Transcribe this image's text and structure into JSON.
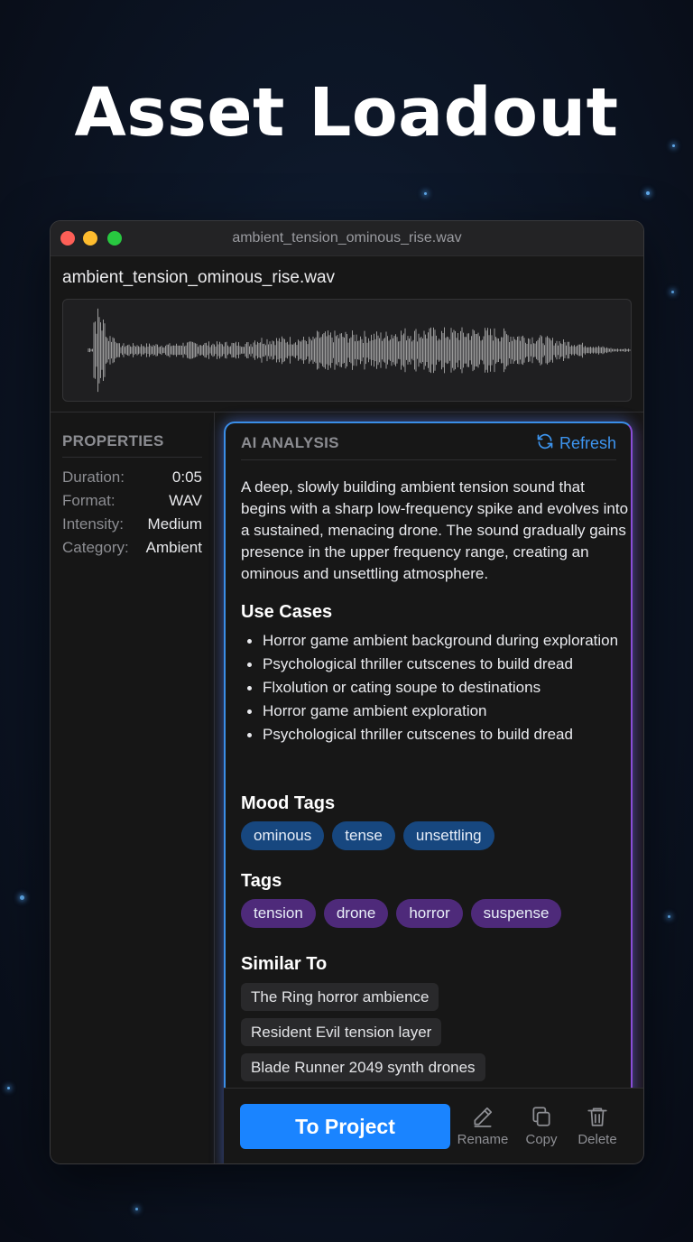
{
  "hero": {
    "title": "Asset Loadout"
  },
  "window": {
    "title": "ambient_tension_ominous_rise.wav",
    "file_name": "ambient_tension_ominous_rise.wav"
  },
  "properties": {
    "heading": "PROPERTIES",
    "rows": [
      {
        "key": "Duration:",
        "value": "0:05"
      },
      {
        "key": "Format:",
        "value": "WAV"
      },
      {
        "key": "Intensity:",
        "value": "Medium"
      },
      {
        "key": "Category:",
        "value": "Ambient"
      }
    ]
  },
  "analysis": {
    "heading": "AI ANALYSIS",
    "refresh_label": "Refresh",
    "description": "A deep, slowly building ambient tension sound that begins with a sharp low-frequency spike and evolves into a sustained, menacing drone. The sound gradually gains presence in the upper frequency range, creating an ominous and unsettling atmosphere.",
    "use_cases_title": "Use Cases",
    "use_cases": [
      "Horror game ambient background during exploration",
      "Psychological thriller cutscenes to build dread",
      "Flxolution or cating soupe to destinations",
      "Horror game ambient exploration",
      "Psychological thriller cutscenes to build dread"
    ],
    "mood_tags_title": "Mood Tags",
    "mood_tags": [
      "ominous",
      "tense",
      "unsettling"
    ],
    "tags_title": "Tags",
    "tags": [
      "tension",
      "drone",
      "horror",
      "suspense"
    ],
    "similar_title": "Similar To",
    "similar": [
      "The Ring horror ambience",
      "Resident Evil tension layer",
      "Blade Runner 2049 synth drones"
    ]
  },
  "footer": {
    "primary_label": "To Project",
    "rename_label": "Rename",
    "copy_label": "Copy",
    "delete_label": "Delete"
  },
  "colors": {
    "accent": "#1a84ff",
    "mood_chip": "#17477f",
    "tag_chip": "#4e2a7a",
    "waveform": "#9a9a9a"
  },
  "icons": {
    "refresh": "refresh-icon",
    "rename": "pencil-icon",
    "copy": "copy-icon",
    "delete": "trash-icon"
  }
}
